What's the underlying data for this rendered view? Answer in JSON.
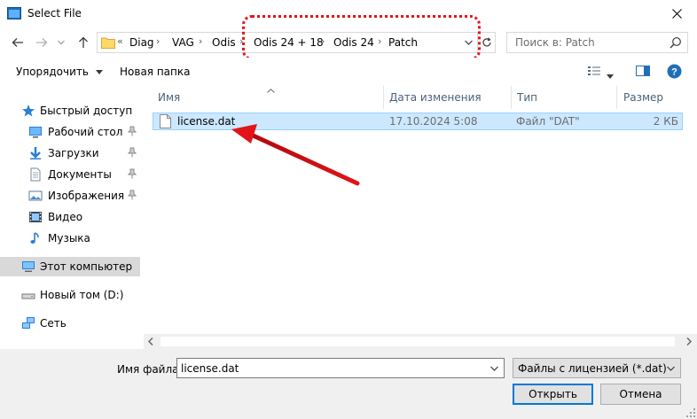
{
  "window": {
    "title": "Select File"
  },
  "address": {
    "overflow": "«",
    "crumbs": [
      "Diag",
      "VAG",
      "Odis",
      "Odis 24 + 18",
      "Odis 24",
      "Patch"
    ]
  },
  "search": {
    "placeholder": "Поиск в: Patch"
  },
  "toolbar": {
    "organize": "Упорядочить",
    "new_folder": "Новая папка"
  },
  "sidebar": {
    "items": [
      {
        "label": "Быстрый доступ",
        "icon": "star-icon"
      },
      {
        "label": "Рабочий стол",
        "icon": "desktop-icon"
      },
      {
        "label": "Загрузки",
        "icon": "download-icon"
      },
      {
        "label": "Документы",
        "icon": "documents-icon"
      },
      {
        "label": "Изображения",
        "icon": "pictures-icon"
      },
      {
        "label": "Видео",
        "icon": "video-icon"
      },
      {
        "label": "Музыка",
        "icon": "music-icon"
      },
      {
        "label": "Этот компьютер",
        "icon": "computer-icon"
      },
      {
        "label": "Новый том (D:)",
        "icon": "drive-icon"
      },
      {
        "label": "Сеть",
        "icon": "network-icon"
      }
    ]
  },
  "columns": {
    "name": "Имя",
    "date": "Дата изменения",
    "type": "Тип",
    "size": "Размер"
  },
  "files": [
    {
      "name": "license.dat",
      "date": "17.10.2024 5:08",
      "type": "Файл \"DAT\"",
      "size": "2 КБ"
    }
  ],
  "footer": {
    "filename_label": "Имя файла:",
    "filename_value": "license.dat",
    "filetype": "Файлы с лицензией (*.dat)",
    "open": "Открыть",
    "cancel": "Отмена"
  },
  "colors": {
    "accent": "#0078d7",
    "annotation": "#e1141a",
    "selection": "#cce8ff"
  }
}
